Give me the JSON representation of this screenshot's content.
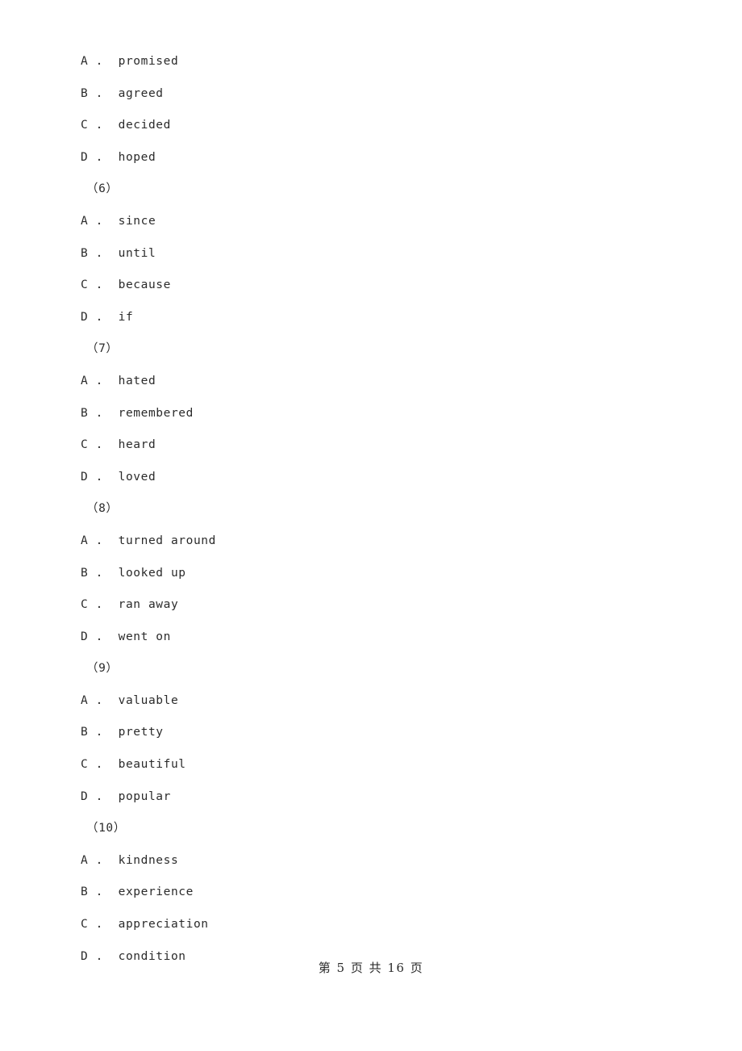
{
  "document": {
    "type": "exam-paper",
    "page_number": 5,
    "total_pages": 16,
    "footer_text": "第 5 页 共 16 页",
    "text_color": "#2b2b2b",
    "background_color": "#ffffff"
  },
  "lines": [
    {
      "kind": "option",
      "text": "A .  promised"
    },
    {
      "kind": "option",
      "text": "B .  agreed"
    },
    {
      "kind": "option",
      "text": "C .  decided"
    },
    {
      "kind": "option",
      "text": "D .  hoped"
    },
    {
      "kind": "qnum",
      "text": "（6）"
    },
    {
      "kind": "option",
      "text": "A .  since"
    },
    {
      "kind": "option",
      "text": "B .  until"
    },
    {
      "kind": "option",
      "text": "C .  because"
    },
    {
      "kind": "option",
      "text": "D .  if"
    },
    {
      "kind": "qnum",
      "text": "（7）"
    },
    {
      "kind": "option",
      "text": "A .  hated"
    },
    {
      "kind": "option",
      "text": "B .  remembered"
    },
    {
      "kind": "option",
      "text": "C .  heard"
    },
    {
      "kind": "option",
      "text": "D .  loved"
    },
    {
      "kind": "qnum",
      "text": "（8）"
    },
    {
      "kind": "option",
      "text": "A .  turned around"
    },
    {
      "kind": "option",
      "text": "B .  looked up"
    },
    {
      "kind": "option",
      "text": "C .  ran away"
    },
    {
      "kind": "option",
      "text": "D .  went on"
    },
    {
      "kind": "qnum",
      "text": "（9）"
    },
    {
      "kind": "option",
      "text": "A .  valuable"
    },
    {
      "kind": "option",
      "text": "B .  pretty"
    },
    {
      "kind": "option",
      "text": "C .  beautiful"
    },
    {
      "kind": "option",
      "text": "D .  popular"
    },
    {
      "kind": "qnum",
      "text": "（10）"
    },
    {
      "kind": "option",
      "text": "A .  kindness"
    },
    {
      "kind": "option",
      "text": "B .  experience"
    },
    {
      "kind": "option",
      "text": "C .  appreciation"
    },
    {
      "kind": "option",
      "text": "D .  condition"
    }
  ],
  "questions": [
    {
      "number": "（6）",
      "options": [
        {
          "letter": "A",
          "text": "since"
        },
        {
          "letter": "B",
          "text": "until"
        },
        {
          "letter": "C",
          "text": "because"
        },
        {
          "letter": "D",
          "text": "if"
        }
      ]
    },
    {
      "number": "（7）",
      "options": [
        {
          "letter": "A",
          "text": "hated"
        },
        {
          "letter": "B",
          "text": "remembered"
        },
        {
          "letter": "C",
          "text": "heard"
        },
        {
          "letter": "D",
          "text": "loved"
        }
      ]
    },
    {
      "number": "（8）",
      "options": [
        {
          "letter": "A",
          "text": "turned around"
        },
        {
          "letter": "B",
          "text": "looked up"
        },
        {
          "letter": "C",
          "text": "ran away"
        },
        {
          "letter": "D",
          "text": "went on"
        }
      ]
    },
    {
      "number": "（9）",
      "options": [
        {
          "letter": "A",
          "text": "valuable"
        },
        {
          "letter": "B",
          "text": "pretty"
        },
        {
          "letter": "C",
          "text": "beautiful"
        },
        {
          "letter": "D",
          "text": "popular"
        }
      ]
    },
    {
      "number": "（10）",
      "options": [
        {
          "letter": "A",
          "text": "kindness"
        },
        {
          "letter": "B",
          "text": "experience"
        },
        {
          "letter": "C",
          "text": "appreciation"
        },
        {
          "letter": "D",
          "text": "condition"
        }
      ]
    }
  ]
}
